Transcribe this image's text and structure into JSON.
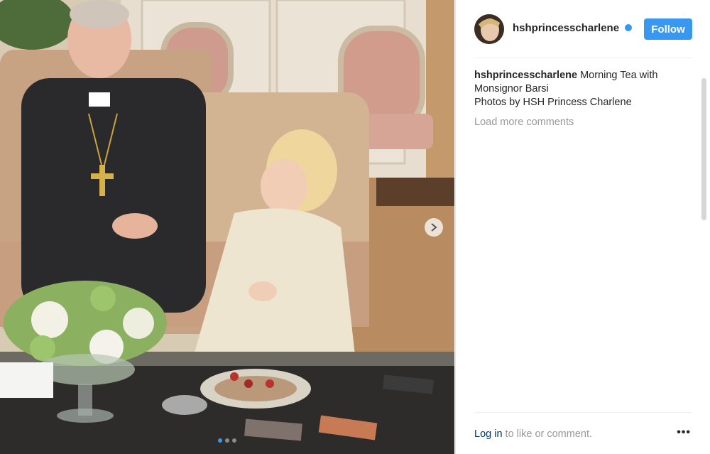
{
  "header": {
    "username": "hshprincesscharlene",
    "follow_label": "Follow"
  },
  "caption": {
    "username": "hshprincesscharlene",
    "text_line1": " Morning Tea with",
    "text_line2": "Monsignor Barsi",
    "text_line3": "Photos by HSH Princess Charlene"
  },
  "comments": {
    "load_more_label": "Load more comments"
  },
  "footer": {
    "login_link": "Log in",
    "login_suffix": " to like or comment.",
    "more_icon": "ellipsis-icon"
  },
  "carousel": {
    "slide_count": 3,
    "active_slide": 1
  },
  "colors": {
    "accent": "#3897f0",
    "link": "#003569",
    "muted": "#999999",
    "text": "#262626"
  }
}
